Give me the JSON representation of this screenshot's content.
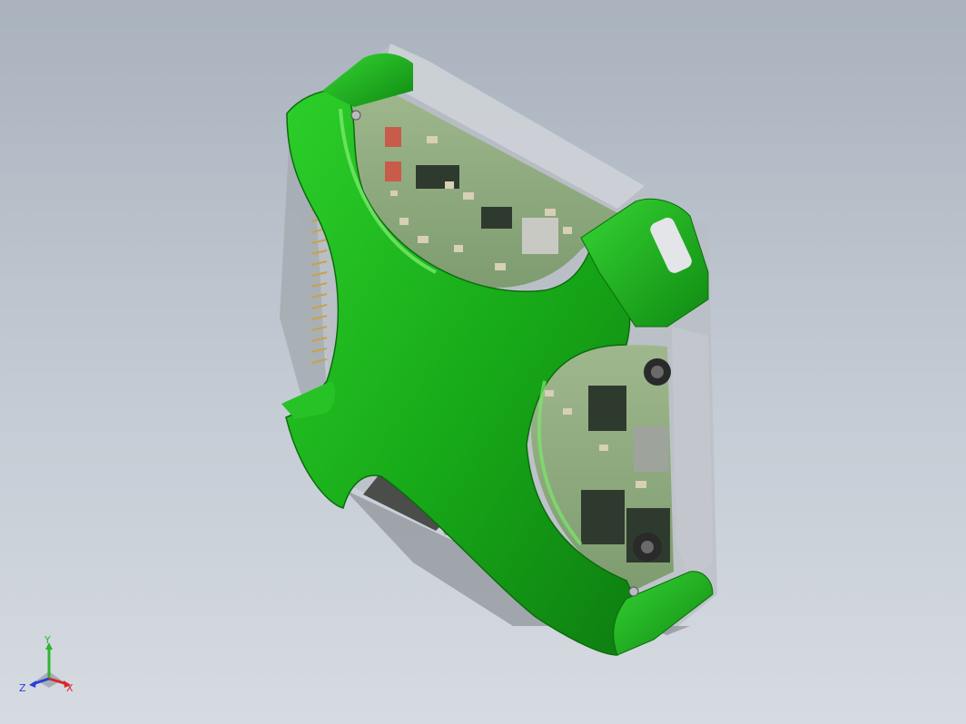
{
  "view": {
    "background_top": "#a9b2bd",
    "background_bottom": "#d6dbe1"
  },
  "model": {
    "bumper_color": "#1fb81f",
    "bumper_dark": "#0f7a12",
    "bumper_highlight": "#7be86a",
    "enclosure_color": "#c9ccd0",
    "pcb_color": "#8fae7e",
    "connector_pin_color": "#c8a24a"
  },
  "triad": {
    "x_label": "X",
    "y_label": "Y",
    "z_label": "Z",
    "x_color": "#d9262b",
    "y_color": "#2fb52f",
    "z_color": "#2b3fd9"
  }
}
